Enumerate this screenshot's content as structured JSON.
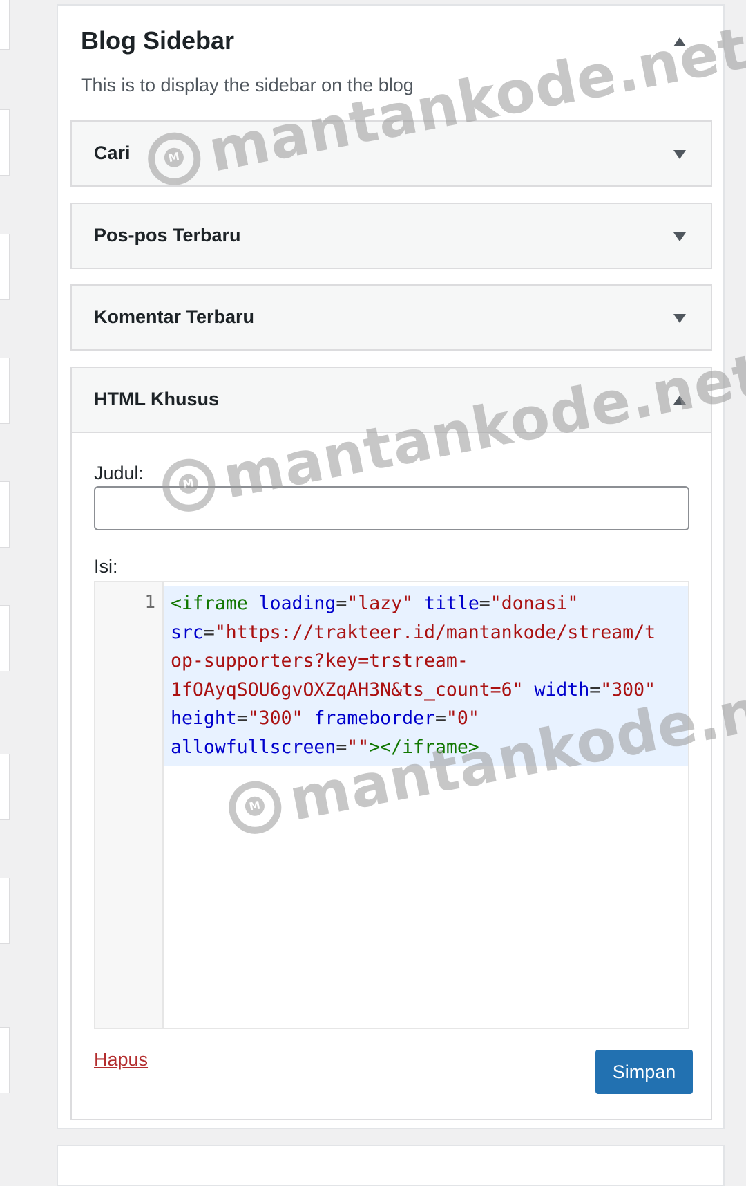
{
  "sidebar": {
    "title": "Blog Sidebar",
    "description": "This is to display the sidebar on the blog",
    "widgets": [
      {
        "title": "Cari"
      },
      {
        "title": "Pos-pos Terbaru"
      },
      {
        "title": "Komentar Terbaru"
      }
    ]
  },
  "html_widget": {
    "title": "HTML Khusus",
    "title_label": "Judul:",
    "title_value": "",
    "content_label": "Isi:",
    "line_number": "1",
    "code_tokens": {
      "l1_tag": "<iframe",
      "l1_attr1": "loading",
      "l1_val1": "\"lazy\"",
      "l1_attr2": "title",
      "l1_val2": "\"donasi\"",
      "l2_attr": "src",
      "l2_val": "\"https://trakteer.id/mantankode/stream/t",
      "l3_val": "op-supporters?key=trstream-",
      "l4_val": "1fOAyqSOU6gvOXZqAH3N&ts_count=6\"",
      "l4_attr": "width",
      "l4_val2": "\"300\"",
      "l5_attr1": "height",
      "l5_val1": "\"300\"",
      "l5_attr2": "frameborder",
      "l5_val2": "\"0\"",
      "l6_attr": "allowfullscreen",
      "l6_val": "\"\"",
      "l6_tag": "></iframe>"
    },
    "delete_label": "Hapus",
    "save_label": "Simpan"
  },
  "watermark": {
    "text": "mantankode.net",
    "logo_letter": "M"
  },
  "colors": {
    "primary_button": "#2271b1",
    "delete_link": "#b32d2e",
    "code_highlight": "#e8f2ff",
    "tag": "#117700",
    "attribute": "#0000cc",
    "string": "#aa1111"
  }
}
